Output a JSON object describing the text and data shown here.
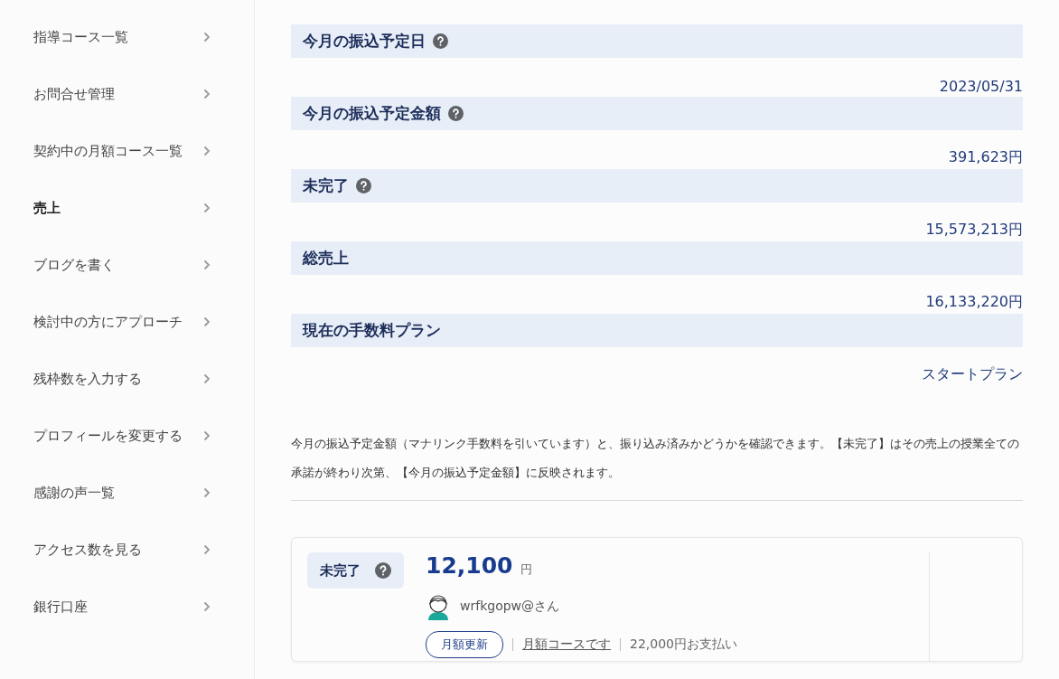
{
  "sidebar": {
    "items": [
      {
        "label": "指導コース一覧",
        "selected": false
      },
      {
        "label": "お問合せ管理",
        "selected": false
      },
      {
        "label": "契約中の月額コース一覧",
        "selected": false
      },
      {
        "label": "売上",
        "selected": true
      },
      {
        "label": "ブログを書く",
        "selected": false
      },
      {
        "label": "検討中の方にアプローチ",
        "selected": false
      },
      {
        "label": "残枠数を入力する",
        "selected": false
      },
      {
        "label": "プロフィールを変更する",
        "selected": false
      },
      {
        "label": "感謝の声一覧",
        "selected": false
      },
      {
        "label": "アクセス数を見る",
        "selected": false
      },
      {
        "label": "銀行口座",
        "selected": false
      }
    ]
  },
  "sections": [
    {
      "title": "今月の振込予定日",
      "help": true,
      "value": "2023/05/31"
    },
    {
      "title": "今月の振込予定金額",
      "help": true,
      "value": "391,623円"
    },
    {
      "title": "未完了",
      "help": true,
      "value": "15,573,213円"
    },
    {
      "title": "総売上",
      "help": false,
      "value": "16,133,220円"
    },
    {
      "title": "現在の手数料プラン",
      "help": false,
      "value": "スタートプラン"
    }
  ],
  "description": "今月の振込予定金額（マナリンク手数料を引いています）と、振り込み済みかどうかを確認できます。【未完了】はその売上の授業全ての承諾が終わり次第、【今月の振込予定金額】に反映されます。",
  "card": {
    "status": "未完了",
    "status_help": true,
    "amount": "12,100",
    "unit": "円",
    "user": "wrfkgopw@さん",
    "tag": "月額更新",
    "link": "月額コースです",
    "payment": "22,000円お支払い"
  }
}
